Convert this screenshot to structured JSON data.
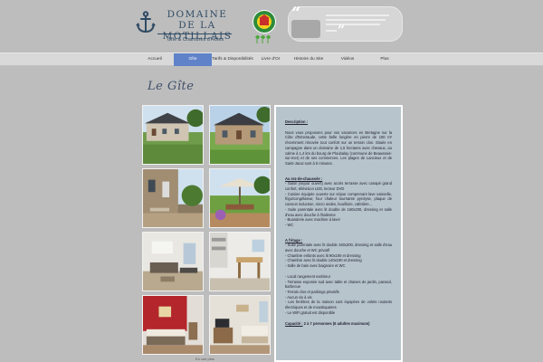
{
  "brand": {
    "title_line1": "DOMAINE DE LA",
    "title_line2": "MOTILLAIS",
    "subtitle": "Gîte & Chambres d'Hôtes"
  },
  "nav": {
    "items": [
      {
        "label": "Accueil"
      },
      {
        "label": "Gîte"
      },
      {
        "label": "Tarifs & Disponibilités"
      },
      {
        "label": "Livre d'Or"
      },
      {
        "label": "Histoire du Site"
      },
      {
        "label": "Vidéos"
      },
      {
        "label": "Plus"
      }
    ],
    "active_index": 1
  },
  "section_title": "Le Gîte",
  "photo_caption": "En voir plus",
  "description": {
    "heading1": "Description :",
    "intro": "Nous vous proposons pour vos vacances en Bretagne sur la Côte d'Emeraude, cette belle longère en pierre de 100 m² récemment rénovée tout confort sur un terrain clos. Située en campagne dans un domaine de 1,5 hectares avec chevaux, au calme à 1,4 km du bourg de Ploubalay (commune de Beaussais-sur-mer) et de ses commerces. Les plages de Lancieux et de Saint-Jacut sont à 5 minutes.",
    "heading2": "Au rez-de-chaussée :",
    "rdc": [
      "- Salon (séjour ouvert) avec accès terrasse avec canapé grand confort, télévision LED, lecteur DVD",
      "- Cuisine équipée ouverte sur séjour comprenant lave vaisselle, frigo/congélateur, four chaleur tournante pyrolyse, plaque de cuisson induction, micro ondes, bouilloire, cafetière...",
      "- Suite parentale avec lit double de 160x200, dressing et salle d'eau avec douche à l'italienne",
      "- Buanderie avec machine à laver",
      "- WC"
    ],
    "heading3": "A l'étage :",
    "etage": [
      "- Suite parentale avec lit double 160x200, dressing et salle d'eau avec douche et WC privatif",
      "- Chambre enfants avec lit 90x190 et dressing",
      "- Chambre avec lit double 140x190 et dressing",
      "- Salle de bain avec baignoire et WC"
    ],
    "extras": [
      "- Local rangement extérieur",
      "- Terrasse exposée sud avec table et chaises de jardin, parasol, barbecue",
      "- Terrain clos et parkings privatifs",
      "- Aucun vis à vis",
      "- Les fenêtres de la maison sont équipées de volets roulants électriques et de moustiquaires",
      "- Le WiFi gratuit est disponible"
    ],
    "capacity_label": "Capacité :",
    "capacity_value": " 2 à 7 personnes (6 adultes maximum)"
  },
  "colors": {
    "page_bg": "#bdbdbd",
    "brand_navy": "#2f4a63",
    "nav_active": "#5f82c9",
    "panel_bg": "#b7c4cc"
  },
  "icons": {
    "logo": "anchor-icon",
    "badge": "gites-de-france-badge"
  }
}
